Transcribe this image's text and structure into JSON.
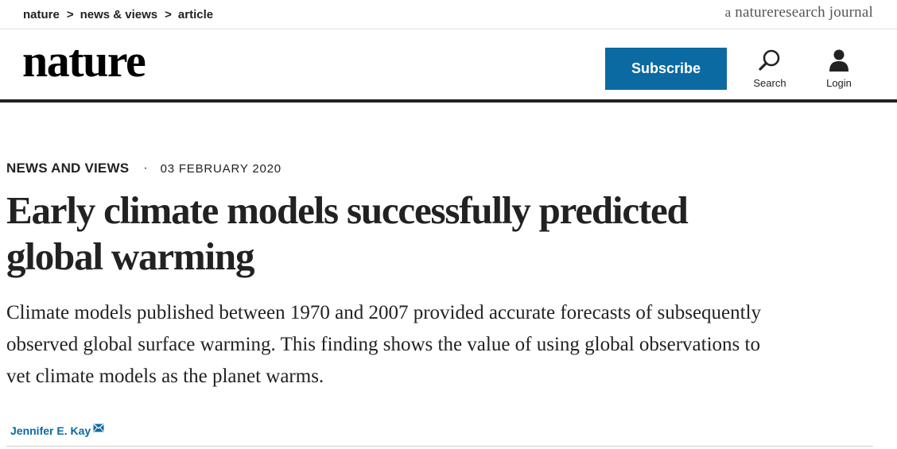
{
  "breadcrumb": {
    "items": [
      "nature",
      "news & views",
      "article"
    ],
    "separator": ">"
  },
  "journal_tag": {
    "prefix": "a",
    "brand": "natureresearch",
    "suffix": "journal"
  },
  "header": {
    "logo": "nature",
    "subscribe_label": "Subscribe",
    "search_label": "Search",
    "login_label": "Login",
    "search_icon": "search-icon",
    "login_icon": "user-icon"
  },
  "article": {
    "type": "NEWS AND VIEWS",
    "dot": "·",
    "date": "03 FEBRUARY 2020",
    "title": "Early climate models successfully predicted global warming",
    "standfirst": "Climate models published between 1970 and 2007 provided accurate forecasts of subsequently observed global surface warming. This finding shows the value of using global observations to vet climate models as the planet warms.",
    "author": "Jennifer E. Kay",
    "author_icon": "mail-icon"
  },
  "colors": {
    "accent": "#0a6aa1",
    "text": "#222222",
    "rule": "#222222"
  }
}
